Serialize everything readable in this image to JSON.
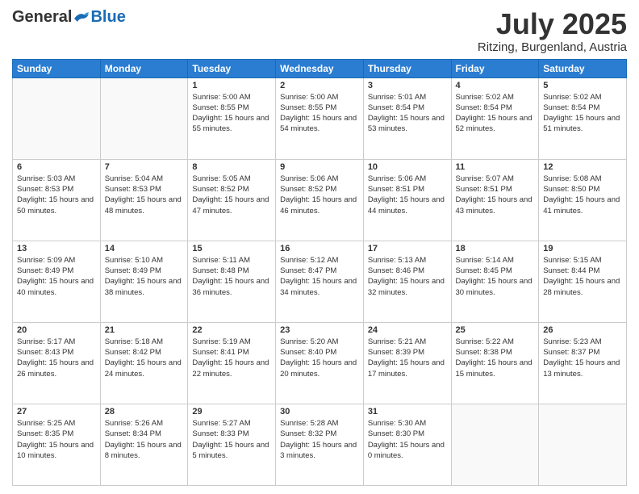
{
  "header": {
    "logo_general": "General",
    "logo_blue": "Blue",
    "month": "July 2025",
    "location": "Ritzing, Burgenland, Austria"
  },
  "weekdays": [
    "Sunday",
    "Monday",
    "Tuesday",
    "Wednesday",
    "Thursday",
    "Friday",
    "Saturday"
  ],
  "weeks": [
    [
      {
        "day": "",
        "sunrise": "",
        "sunset": "",
        "daylight": ""
      },
      {
        "day": "",
        "sunrise": "",
        "sunset": "",
        "daylight": ""
      },
      {
        "day": "1",
        "sunrise": "Sunrise: 5:00 AM",
        "sunset": "Sunset: 8:55 PM",
        "daylight": "Daylight: 15 hours and 55 minutes."
      },
      {
        "day": "2",
        "sunrise": "Sunrise: 5:00 AM",
        "sunset": "Sunset: 8:55 PM",
        "daylight": "Daylight: 15 hours and 54 minutes."
      },
      {
        "day": "3",
        "sunrise": "Sunrise: 5:01 AM",
        "sunset": "Sunset: 8:54 PM",
        "daylight": "Daylight: 15 hours and 53 minutes."
      },
      {
        "day": "4",
        "sunrise": "Sunrise: 5:02 AM",
        "sunset": "Sunset: 8:54 PM",
        "daylight": "Daylight: 15 hours and 52 minutes."
      },
      {
        "day": "5",
        "sunrise": "Sunrise: 5:02 AM",
        "sunset": "Sunset: 8:54 PM",
        "daylight": "Daylight: 15 hours and 51 minutes."
      }
    ],
    [
      {
        "day": "6",
        "sunrise": "Sunrise: 5:03 AM",
        "sunset": "Sunset: 8:53 PM",
        "daylight": "Daylight: 15 hours and 50 minutes."
      },
      {
        "day": "7",
        "sunrise": "Sunrise: 5:04 AM",
        "sunset": "Sunset: 8:53 PM",
        "daylight": "Daylight: 15 hours and 48 minutes."
      },
      {
        "day": "8",
        "sunrise": "Sunrise: 5:05 AM",
        "sunset": "Sunset: 8:52 PM",
        "daylight": "Daylight: 15 hours and 47 minutes."
      },
      {
        "day": "9",
        "sunrise": "Sunrise: 5:06 AM",
        "sunset": "Sunset: 8:52 PM",
        "daylight": "Daylight: 15 hours and 46 minutes."
      },
      {
        "day": "10",
        "sunrise": "Sunrise: 5:06 AM",
        "sunset": "Sunset: 8:51 PM",
        "daylight": "Daylight: 15 hours and 44 minutes."
      },
      {
        "day": "11",
        "sunrise": "Sunrise: 5:07 AM",
        "sunset": "Sunset: 8:51 PM",
        "daylight": "Daylight: 15 hours and 43 minutes."
      },
      {
        "day": "12",
        "sunrise": "Sunrise: 5:08 AM",
        "sunset": "Sunset: 8:50 PM",
        "daylight": "Daylight: 15 hours and 41 minutes."
      }
    ],
    [
      {
        "day": "13",
        "sunrise": "Sunrise: 5:09 AM",
        "sunset": "Sunset: 8:49 PM",
        "daylight": "Daylight: 15 hours and 40 minutes."
      },
      {
        "day": "14",
        "sunrise": "Sunrise: 5:10 AM",
        "sunset": "Sunset: 8:49 PM",
        "daylight": "Daylight: 15 hours and 38 minutes."
      },
      {
        "day": "15",
        "sunrise": "Sunrise: 5:11 AM",
        "sunset": "Sunset: 8:48 PM",
        "daylight": "Daylight: 15 hours and 36 minutes."
      },
      {
        "day": "16",
        "sunrise": "Sunrise: 5:12 AM",
        "sunset": "Sunset: 8:47 PM",
        "daylight": "Daylight: 15 hours and 34 minutes."
      },
      {
        "day": "17",
        "sunrise": "Sunrise: 5:13 AM",
        "sunset": "Sunset: 8:46 PM",
        "daylight": "Daylight: 15 hours and 32 minutes."
      },
      {
        "day": "18",
        "sunrise": "Sunrise: 5:14 AM",
        "sunset": "Sunset: 8:45 PM",
        "daylight": "Daylight: 15 hours and 30 minutes."
      },
      {
        "day": "19",
        "sunrise": "Sunrise: 5:15 AM",
        "sunset": "Sunset: 8:44 PM",
        "daylight": "Daylight: 15 hours and 28 minutes."
      }
    ],
    [
      {
        "day": "20",
        "sunrise": "Sunrise: 5:17 AM",
        "sunset": "Sunset: 8:43 PM",
        "daylight": "Daylight: 15 hours and 26 minutes."
      },
      {
        "day": "21",
        "sunrise": "Sunrise: 5:18 AM",
        "sunset": "Sunset: 8:42 PM",
        "daylight": "Daylight: 15 hours and 24 minutes."
      },
      {
        "day": "22",
        "sunrise": "Sunrise: 5:19 AM",
        "sunset": "Sunset: 8:41 PM",
        "daylight": "Daylight: 15 hours and 22 minutes."
      },
      {
        "day": "23",
        "sunrise": "Sunrise: 5:20 AM",
        "sunset": "Sunset: 8:40 PM",
        "daylight": "Daylight: 15 hours and 20 minutes."
      },
      {
        "day": "24",
        "sunrise": "Sunrise: 5:21 AM",
        "sunset": "Sunset: 8:39 PM",
        "daylight": "Daylight: 15 hours and 17 minutes."
      },
      {
        "day": "25",
        "sunrise": "Sunrise: 5:22 AM",
        "sunset": "Sunset: 8:38 PM",
        "daylight": "Daylight: 15 hours and 15 minutes."
      },
      {
        "day": "26",
        "sunrise": "Sunrise: 5:23 AM",
        "sunset": "Sunset: 8:37 PM",
        "daylight": "Daylight: 15 hours and 13 minutes."
      }
    ],
    [
      {
        "day": "27",
        "sunrise": "Sunrise: 5:25 AM",
        "sunset": "Sunset: 8:35 PM",
        "daylight": "Daylight: 15 hours and 10 minutes."
      },
      {
        "day": "28",
        "sunrise": "Sunrise: 5:26 AM",
        "sunset": "Sunset: 8:34 PM",
        "daylight": "Daylight: 15 hours and 8 minutes."
      },
      {
        "day": "29",
        "sunrise": "Sunrise: 5:27 AM",
        "sunset": "Sunset: 8:33 PM",
        "daylight": "Daylight: 15 hours and 5 minutes."
      },
      {
        "day": "30",
        "sunrise": "Sunrise: 5:28 AM",
        "sunset": "Sunset: 8:32 PM",
        "daylight": "Daylight: 15 hours and 3 minutes."
      },
      {
        "day": "31",
        "sunrise": "Sunrise: 5:30 AM",
        "sunset": "Sunset: 8:30 PM",
        "daylight": "Daylight: 15 hours and 0 minutes."
      },
      {
        "day": "",
        "sunrise": "",
        "sunset": "",
        "daylight": ""
      },
      {
        "day": "",
        "sunrise": "",
        "sunset": "",
        "daylight": ""
      }
    ]
  ]
}
